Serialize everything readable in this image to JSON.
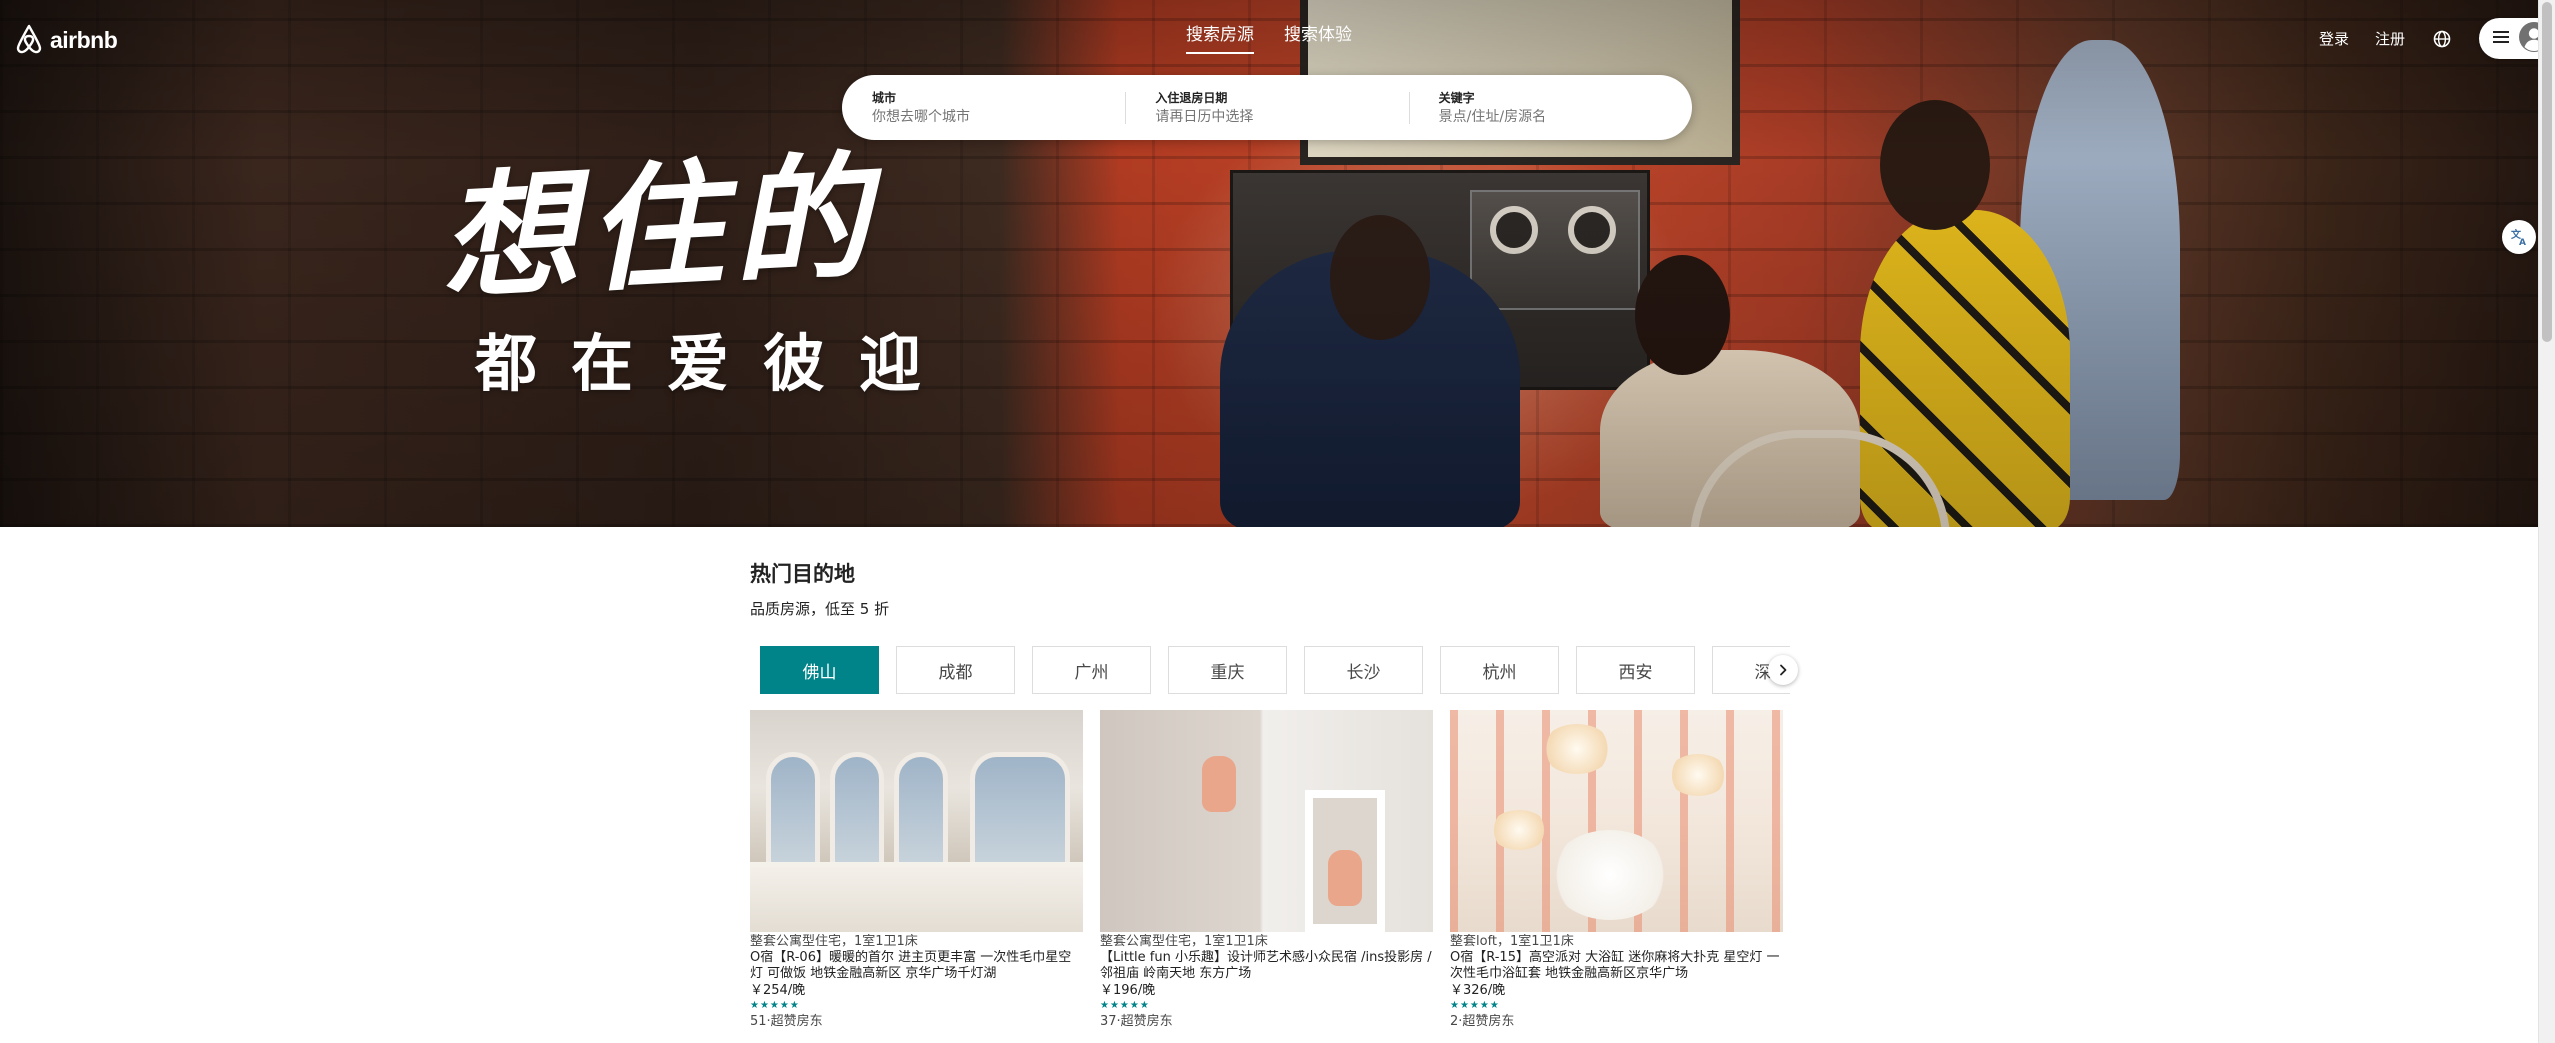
{
  "brand": {
    "logo_text": "airbnb"
  },
  "nav": {
    "tabs": [
      "搜索房源",
      "搜索体验"
    ],
    "login": "登录",
    "register": "注册"
  },
  "search": {
    "fields": [
      {
        "label": "城市",
        "placeholder": "你想去哪个城市"
      },
      {
        "label": "入住退房日期",
        "placeholder": "请再日历中选择"
      },
      {
        "label": "关键字",
        "placeholder": "景点/住址/房源名"
      }
    ]
  },
  "hero": {
    "title": "想住的",
    "subtitle": "都在爱彼迎"
  },
  "destinations": {
    "title": "热门目的地",
    "subtitle": "品质房源，低至 5 折",
    "cities": [
      "佛山",
      "成都",
      "广州",
      "重庆",
      "长沙",
      "杭州",
      "西安",
      "深圳"
    ],
    "active_city": "佛山",
    "accent_color": "#008489"
  },
  "listings": [
    {
      "type": "整套公寓型住宅，1室1卫1床",
      "title": "O宿【R-06】暖暖的首尔 进主页更丰富 一次性毛巾星空灯 可做饭 地铁金融高新区 京华广场千灯湖",
      "price": "￥254/晚",
      "stars": "★★★★★",
      "reviews": "51·超赞房东"
    },
    {
      "type": "整套公寓型住宅，1室1卫1床",
      "title": "【Little fun 小乐趣】设计师艺术感小众民宿 /ins投影房 /邻祖庙 岭南天地 东方广场",
      "price": "￥196/晚",
      "stars": "★★★★★",
      "reviews": "37·超赞房东"
    },
    {
      "type": "整套loft，1室1卫1床",
      "title": "O宿【R-15】高空派对 大浴缸 迷你麻将大扑克 星空灯 一次性毛巾浴缸套 地铁金融高新区京华广场",
      "price": "￥326/晚",
      "stars": "★★★★★",
      "reviews": "2·超赞房东"
    }
  ],
  "icons": {
    "logo": "airbnb-logo-icon",
    "globe": "globe-icon",
    "menu": "hamburger-menu-icon",
    "avatar": "user-avatar-icon",
    "next": "chevron-right-icon",
    "translate": "translate-icon"
  },
  "colors": {
    "accent": "#008489",
    "text": "#222222"
  }
}
